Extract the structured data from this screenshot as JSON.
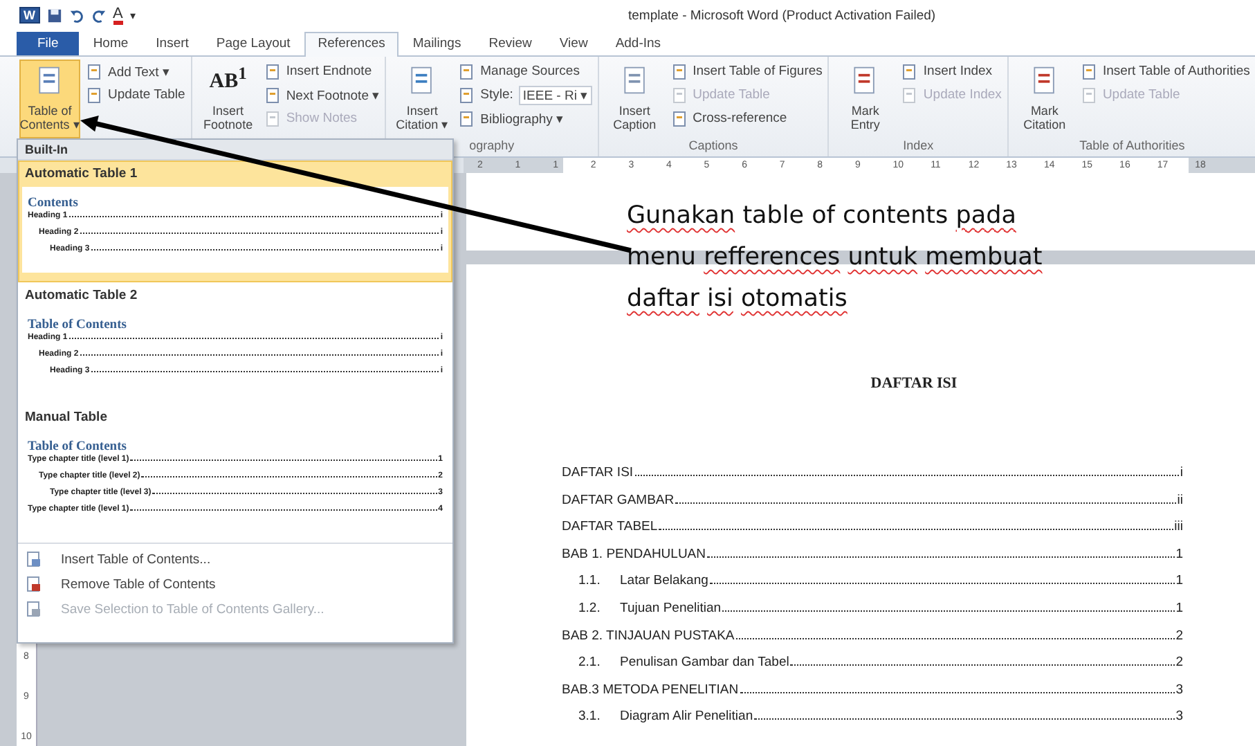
{
  "window": {
    "title": "template  -  Microsoft Word (Product Activation Failed)"
  },
  "quick_access": {
    "logo": "W",
    "font_color_glyph": "A",
    "more": "▾"
  },
  "tabs": [
    {
      "label": "File",
      "kind": "file",
      "selected": false
    },
    {
      "label": "Home",
      "kind": "tab",
      "selected": false
    },
    {
      "label": "Insert",
      "kind": "tab",
      "selected": false
    },
    {
      "label": "Page Layout",
      "kind": "tab",
      "selected": false
    },
    {
      "label": "References",
      "kind": "tab",
      "selected": true
    },
    {
      "label": "Mailings",
      "kind": "tab",
      "selected": false
    },
    {
      "label": "Review",
      "kind": "tab",
      "selected": false
    },
    {
      "label": "View",
      "kind": "tab",
      "selected": false
    },
    {
      "label": "Add-Ins",
      "kind": "tab",
      "selected": false
    }
  ],
  "ribbon": {
    "groups": [
      {
        "large": {
          "lines": [
            "Table of",
            "Contents ▾"
          ],
          "kind": "document",
          "selected": true
        },
        "small": [
          {
            "kind": "button",
            "label": "Add Text ▾",
            "disabled": false
          },
          {
            "kind": "button",
            "label": "Update Table",
            "disabled": false
          }
        ]
      },
      {
        "large": {
          "lines": [
            "Insert",
            "Footnote"
          ],
          "kind": "glyph",
          "glyph": "AB$^{1}$",
          "selected": false
        },
        "small": [
          {
            "kind": "button",
            "label": "Insert Endnote",
            "disabled": false
          },
          {
            "kind": "button",
            "label": "Next Footnote ▾",
            "disabled": false
          },
          {
            "kind": "button",
            "label": "Show Notes",
            "disabled": true
          }
        ]
      },
      {
        "label": "ography",
        "large": {
          "lines": [
            "Insert",
            "Citation ▾"
          ],
          "kind": "document",
          "selected": false
        },
        "small": [
          {
            "kind": "button",
            "label": "Manage Sources",
            "disabled": false
          },
          {
            "kind": "combo",
            "label": "Style:",
            "value": "IEEE - Ri ▾",
            "disabled": false
          },
          {
            "kind": "button",
            "label": "Bibliography ▾",
            "disabled": false
          }
        ]
      },
      {
        "label": "Captions",
        "large": {
          "lines": [
            "Insert",
            "Caption"
          ],
          "kind": "document",
          "selected": false
        },
        "small": [
          {
            "kind": "button",
            "label": "Insert Table of Figures",
            "disabled": false
          },
          {
            "kind": "button",
            "label": "Update Table",
            "disabled": true
          },
          {
            "kind": "button",
            "label": "Cross-reference",
            "disabled": false
          }
        ]
      },
      {
        "label": "Index",
        "large": {
          "lines": [
            "Mark",
            "Entry"
          ],
          "kind": "marker",
          "selected": false
        },
        "small": [
          {
            "kind": "button",
            "label": "Insert Index",
            "disabled": false
          },
          {
            "kind": "button",
            "label": "Update Index",
            "disabled": true
          }
        ]
      },
      {
        "label": "Table of Authorities",
        "large": {
          "lines": [
            "Mark",
            "Citation"
          ],
          "kind": "marker",
          "selected": false
        },
        "small": [
          {
            "kind": "button",
            "label": "Insert Table of Authorities",
            "disabled": false
          },
          {
            "kind": "button",
            "label": "Update Table",
            "disabled": true
          }
        ]
      }
    ]
  },
  "dropdown": {
    "header": "Built-In",
    "sections": [
      {
        "title": "Automatic Table 1",
        "selected": true,
        "preview": {
          "heading": "Contents",
          "entries": [
            {
              "text": "Heading 1",
              "page": "i",
              "children": [
                {
                  "text": "Heading 2",
                  "page": "i",
                  "children": [
                    {
                      "text": "Heading 3",
                      "page": "i"
                    }
                  ]
                }
              ]
            }
          ]
        }
      },
      {
        "title": "Automatic Table 2",
        "selected": false,
        "preview": {
          "heading": "Table of Contents",
          "entries": [
            {
              "text": "Heading 1",
              "page": "i",
              "children": [
                {
                  "text": "Heading 2",
                  "page": "i",
                  "children": [
                    {
                      "text": "Heading 3",
                      "page": "i"
                    }
                  ]
                }
              ]
            }
          ]
        }
      },
      {
        "title": "Manual Table",
        "selected": false,
        "preview": {
          "heading": "Table of Contents",
          "entries": [
            {
              "text": "Type chapter title (level 1)",
              "page": "1",
              "children": [
                {
                  "text": "Type chapter title (level 2)",
                  "page": "2",
                  "children": [
                    {
                      "text": "Type chapter title (level 3)",
                      "page": "3"
                    }
                  ]
                }
              ]
            },
            {
              "text": "Type chapter title (level 1)",
              "page": "4"
            }
          ]
        }
      }
    ],
    "actions": [
      {
        "label": "Insert Table of Contents...",
        "disabled": false
      },
      {
        "label": "Remove Table of Contents",
        "disabled": false
      },
      {
        "label": "Save Selection to Table of Contents Gallery...",
        "disabled": true
      }
    ]
  },
  "ruler": {
    "labels": [
      "2",
      "1",
      "1",
      "2",
      "3",
      "4",
      "5",
      "6",
      "7",
      "8",
      "9",
      "10",
      "11",
      "12",
      "13",
      "14",
      "15",
      "16",
      "17",
      "18"
    ]
  },
  "vertical_ruler": {
    "labels": [
      "8",
      "9",
      "10"
    ]
  },
  "callout": {
    "words": [
      {
        "text": "Gunakan",
        "misspelled": true
      },
      {
        "text": "table",
        "misspelled": false
      },
      {
        "text": "of",
        "misspelled": false
      },
      {
        "text": "contents",
        "misspelled": false
      },
      {
        "text": "pada",
        "misspelled": true
      },
      {
        "text": "menu",
        "misspelled": false
      },
      {
        "text": "refferences",
        "misspelled": true
      },
      {
        "text": "untuk",
        "misspelled": true
      },
      {
        "text": "membuat",
        "misspelled": true
      },
      {
        "text": "daftar",
        "misspelled": true
      },
      {
        "text": "isi",
        "misspelled": true
      },
      {
        "text": "otomatis",
        "misspelled": true
      }
    ]
  },
  "document": {
    "heading": "DAFTAR ISI",
    "toc": [
      {
        "text": "DAFTAR ISI",
        "page": "i"
      },
      {
        "text": "DAFTAR GAMBAR",
        "page": "ii"
      },
      {
        "text": "DAFTAR TABEL",
        "page": "iii"
      },
      {
        "text": "BAB 1. PENDAHULUAN",
        "page": "1",
        "children": [
          {
            "number": "1.1.",
            "text": "Latar Belakang",
            "page": "1"
          },
          {
            "number": "1.2.",
            "text": "Tujuan Penelitian",
            "page": "1"
          }
        ]
      },
      {
        "text": "BAB 2. TINJAUAN PUSTAKA",
        "page": "2",
        "children": [
          {
            "number": "2.1.",
            "text": "Penulisan Gambar dan Tabel",
            "page": "2"
          }
        ]
      },
      {
        "text": "BAB.3 METODA PENELITIAN",
        "page": "3",
        "children": [
          {
            "number": "3.1.",
            "text": "Diagram Alir Penelitian",
            "page": "3"
          }
        ]
      }
    ]
  }
}
